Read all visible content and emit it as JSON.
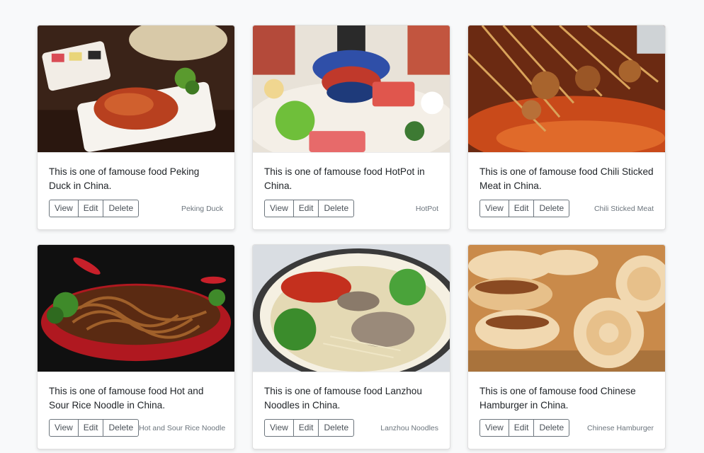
{
  "cards": [
    {
      "text": "This is one of famouse food Peking Duck in China.",
      "caption": "Peking Duck",
      "buttons": {
        "view": "View",
        "edit": "Edit",
        "delete": "Delete"
      },
      "image_icon": "peking-duck-photo",
      "colors": {
        "bg": "#3a2318",
        "plate": "#f2ede6",
        "food": "#b8401f",
        "accent": "#5a9a2e"
      }
    },
    {
      "text": "This is one of famouse food HotPot in China.",
      "caption": "HotPot",
      "buttons": {
        "view": "View",
        "edit": "Edit",
        "delete": "Delete"
      },
      "image_icon": "hotpot-photo",
      "colors": {
        "bg": "#e8e2d8",
        "plate": "#ffffff",
        "food": "#e0564d",
        "accent": "#2f4fa8"
      }
    },
    {
      "text": "This is one of famouse food Chili Sticked Meat in China.",
      "caption": "Chili Sticked Meat",
      "buttons": {
        "view": "View",
        "edit": "Edit",
        "delete": "Delete"
      },
      "image_icon": "chili-sticked-meat-photo",
      "colors": {
        "bg": "#6b2a12",
        "plate": "#c94a1a",
        "food": "#a8642d",
        "accent": "#e8a24a"
      }
    },
    {
      "text": "This is one of famouse food Hot and Sour Rice Noodle in China.",
      "caption": "Hot and Sour Rice Noodle",
      "buttons": {
        "view": "View",
        "edit": "Edit",
        "delete": "Delete"
      },
      "image_icon": "hot-sour-rice-noodle-photo",
      "colors": {
        "bg": "#101010",
        "plate": "#b01820",
        "food": "#7a3a1a",
        "accent": "#3f8a2a"
      }
    },
    {
      "text": "This is one of famouse food Lanzhou Noodles in China.",
      "caption": "Lanzhou Noodles",
      "buttons": {
        "view": "View",
        "edit": "Edit",
        "delete": "Delete"
      },
      "image_icon": "lanzhou-noodles-photo",
      "colors": {
        "bg": "#d9dde2",
        "plate": "#f5f0e2",
        "food": "#e4d9b4",
        "accent": "#3b8c2c"
      }
    },
    {
      "text": "This is one of famouse food Chinese Hamburger in China.",
      "caption": "Chinese Hamburger",
      "buttons": {
        "view": "View",
        "edit": "Edit",
        "delete": "Delete"
      },
      "image_icon": "chinese-hamburger-photo",
      "colors": {
        "bg": "#c98a4a",
        "plate": "#f1d8b0",
        "food": "#8a4a22",
        "accent": "#e7c08a"
      }
    }
  ]
}
